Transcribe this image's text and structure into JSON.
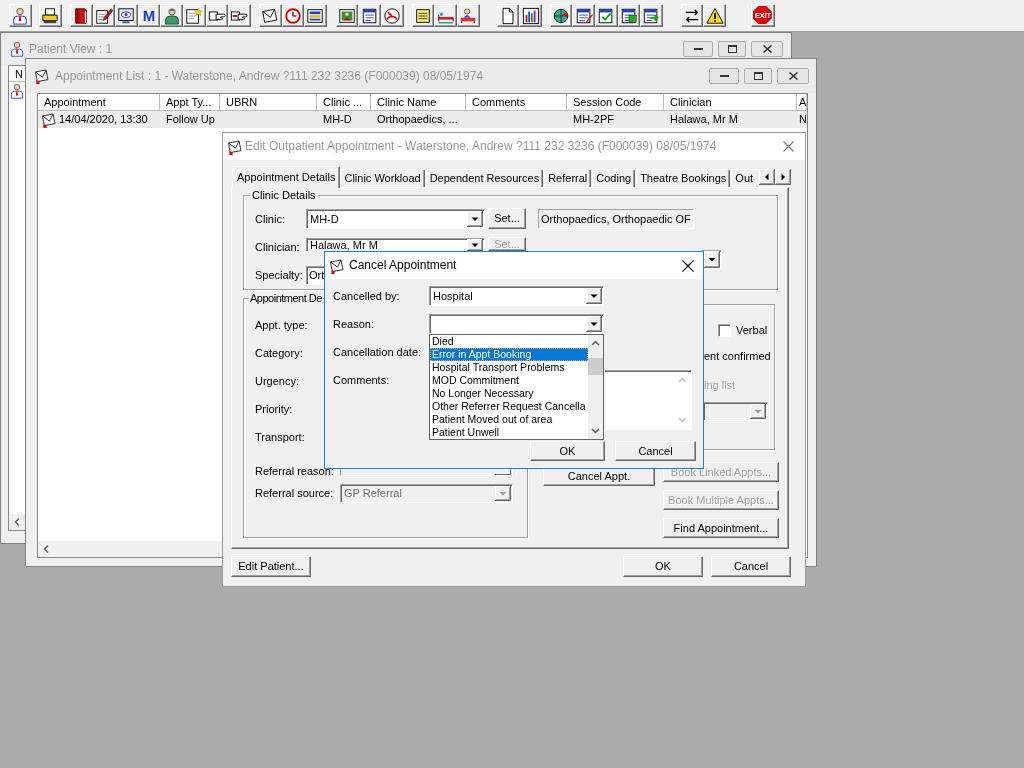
{
  "toolbar": {
    "letter_button": "M",
    "exit_button": "EXIT"
  },
  "patient_view": {
    "title": "Patient View : 1",
    "active": false,
    "column_header": "N"
  },
  "appointment_list": {
    "title": "Appointment List : 1 - Waterstone, Andrew ?111 232 3236 (F000039) 08/05/1974",
    "active": false,
    "columns": [
      "Appointment",
      "Appt Ty...",
      "UBRN",
      "Clinic ...",
      "Clinic Name",
      "Comments",
      "Session Code",
      "Clinician",
      "A"
    ],
    "rows": [
      {
        "appointment": "14/04/2020, 13:30",
        "appt_type": "Follow Up",
        "clinic_code": "MH-D",
        "clinic_name": "Orthopaedics, ...",
        "session_code": "MH-2PF",
        "clinician": "Halawa, Mr M",
        "column_9": "N",
        "selected": true
      }
    ]
  },
  "edit_appointment": {
    "title": "Edit Outpatient Appointment - Waterstone, Andrew ?111 232 3236 (F000039) 08/05/1974",
    "active": false,
    "tabs": [
      {
        "label": "Appointment Details",
        "selected": true
      },
      {
        "label": "Clinic Workload",
        "selected": false
      },
      {
        "label": "Dependent Resources",
        "selected": false
      },
      {
        "label": "Referral",
        "selected": false
      },
      {
        "label": "Coding",
        "selected": false
      },
      {
        "label": "Theatre Bookings",
        "selected": false
      },
      {
        "label": "Out",
        "selected": false
      }
    ],
    "clinic_details": {
      "title": "Clinic Details",
      "clinic": {
        "label": "Clinic:",
        "value": "MH-D",
        "set_button": {
          "label": "Set...",
          "disabled": false
        },
        "description": "Orthopaedics, Orthopaedic OF"
      },
      "clinician": {
        "label": "Clinician:",
        "value": "Halawa, Mr M",
        "set_button": {
          "label": "Set...",
          "disabled": true
        }
      },
      "specialty": {
        "label": "Specialty:",
        "value": "Ort"
      }
    },
    "appointment_details": {
      "title": "Appointment De",
      "labels": [
        "Appt. type:",
        "Category:",
        "Urgency:",
        "Priority:",
        "Transport:"
      ],
      "referral_reason": {
        "label": "Referral reason:",
        "disabled": true
      },
      "referral_source": {
        "label": "Referral source:",
        "value": "GP Referral",
        "disabled": true
      }
    },
    "side_group": {
      "verbal": {
        "label": "Verbal",
        "checked": false
      },
      "confirmed_label": "ent confirmed",
      "waiting_list": {
        "label": "ing list",
        "disabled": true
      },
      "dropdown": {
        "disabled": true
      }
    },
    "actions": [
      {
        "label": "Cancel Appt.",
        "disabled": false
      },
      {
        "label": "Book Linked Appts...",
        "disabled": true
      },
      {
        "label": "Book Multiple Appts...",
        "disabled": true
      },
      {
        "label": "Find Appointment...",
        "disabled": false
      }
    ],
    "footer": {
      "edit_patient": "Edit Patient...",
      "ok": "OK",
      "cancel": "Cancel"
    }
  },
  "cancel_appointment": {
    "title": "Cancel Appointment",
    "active": true,
    "cancelled_by": {
      "label": "Cancelled by:",
      "value": "Hospital"
    },
    "reason": {
      "label": "Reason:",
      "expanded": true,
      "options": [
        {
          "label": "Died",
          "selected": false
        },
        {
          "label": "Error in Appt Booking",
          "selected": true
        },
        {
          "label": "Hospital Transport Problems",
          "selected": false
        },
        {
          "label": "MOD Commitment",
          "selected": false
        },
        {
          "label": "No Longer Necessary",
          "selected": false
        },
        {
          "label": "Other Referrer Request Cancella",
          "selected": false
        },
        {
          "label": "Patient Moved out of area",
          "selected": false
        },
        {
          "label": "Patient Unwell",
          "selected": false
        }
      ]
    },
    "cancellation_date": {
      "label": "Cancellation date:"
    },
    "comments": {
      "label": "Comments:"
    },
    "buttons": [
      "OK",
      "Cancel"
    ]
  }
}
